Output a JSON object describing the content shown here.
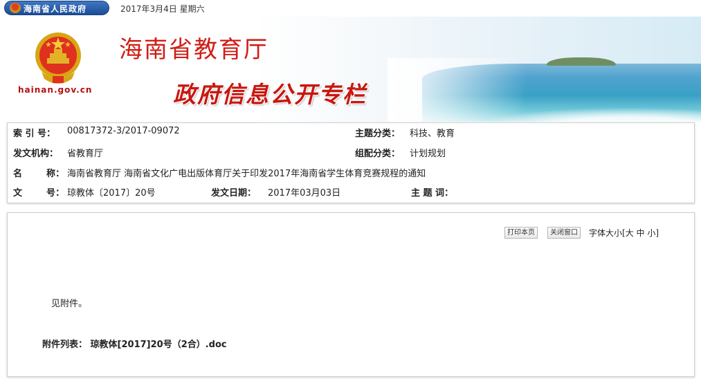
{
  "topbar": {
    "portal_label": "海南省人民政府",
    "date": "2017年3月4日 星期六"
  },
  "banner": {
    "domain": "hainan.gov.cn",
    "site_title": "海南省教育厅",
    "column_title": "政府信息公开专栏"
  },
  "meta": {
    "index_label": "索 引 号：",
    "index_value": "00817372-3/2017-09072",
    "topic_label": "主题分类：",
    "topic_value": "科技、教育",
    "issuer_label": "发文机构：",
    "issuer_value": "省教育厅",
    "group_label": "组配分类：",
    "group_value": "计划规划",
    "name_label_a": "名",
    "name_label_b": "称：",
    "name_value": "海南省教育厅 海南省文化广电出版体育厅关于印发2017年海南省学生体育竞赛规程的通知",
    "docno_label_a": "文",
    "docno_label_b": "号：",
    "docno_value": "琼教体〔2017〕20号",
    "date_label": "发文日期：",
    "date_value": "2017年03月03日",
    "keywords_label": "主 题 词：",
    "keywords_value": ""
  },
  "toolbar": {
    "print_label": "打印本页",
    "close_label": "关闭窗口",
    "fontsize_prefix": "字体大小[",
    "font_large": "大",
    "font_medium": "中",
    "font_small": "小",
    "fontsize_suffix": "]"
  },
  "content": {
    "body_text": "见附件。",
    "attachment_label": "附件列表：",
    "attachment_link": "琼教体[2017]20号（2合）.doc"
  },
  "colors": {
    "title_red": "#cf1d15",
    "portal_blue": "#1c4d96",
    "domain_red": "#b51010"
  },
  "icons": [
    "national-emblem-icon"
  ]
}
